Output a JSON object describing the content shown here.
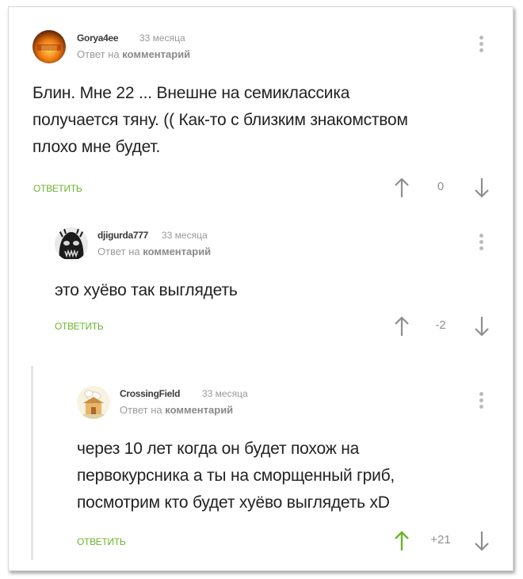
{
  "colors": {
    "accent": "#6cb52d",
    "vote_up_active": "#6cb52d",
    "vote_default": "#8e8e8e"
  },
  "comments": [
    {
      "author": "Gorya4ee",
      "time": "33 месяца",
      "reply_prefix": "Ответ на",
      "reply_target": "комментарий",
      "lines": [
        "Блин. Мне 22 ... Внешне на семиклассика",
        "получается тяну. (( Как-то с близким знакомством",
        "плохо мне будет."
      ],
      "reply_label": "ОТВЕТИТЬ",
      "score": "0",
      "avatar_icon": "fire-avatar-icon"
    },
    {
      "author": "djigurda777",
      "time": "33 месяца",
      "reply_prefix": "Ответ на",
      "reply_target": "комментарий",
      "lines": [
        "это хуёво так выглядеть"
      ],
      "reply_label": "ОТВЕТИТЬ",
      "score": "-2",
      "avatar_icon": "skull-avatar-icon"
    },
    {
      "author": "CrossingField",
      "time": "33 месяца",
      "reply_prefix": "Ответ на",
      "reply_target": "комментарий",
      "lines": [
        "через 10 лет когда он будет похож на",
        "первокурсника а ты на сморщенный гриб,",
        "посмотрим кто будет хуёво выглядеть xD"
      ],
      "reply_label": "ОТВЕТИТЬ",
      "score": "+21",
      "upvoted": true,
      "avatar_icon": "house-avatar-icon"
    }
  ]
}
